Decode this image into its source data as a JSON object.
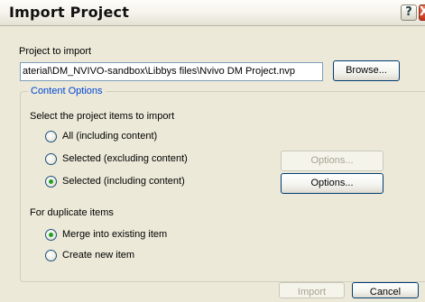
{
  "window": {
    "title": "Import Project",
    "help_glyph": "?",
    "close_glyph": "X"
  },
  "project": {
    "label": "Project to import",
    "path_value": "aterial\\DM_NVIVO-sandbox\\Libbys files\\Nvivo DM Project.nvp",
    "browse_label": "Browse..."
  },
  "content_options": {
    "legend": "Content Options",
    "prompt": "Select the project items to import",
    "items": [
      {
        "label": "All (including content)",
        "selected": false
      },
      {
        "label": "Selected (excluding content)",
        "selected": false,
        "options_label": "Options...",
        "options_enabled": false
      },
      {
        "label": "Selected (including content)",
        "selected": true,
        "options_label": "Options...",
        "options_enabled": true
      }
    ]
  },
  "duplicates": {
    "label": "For duplicate items",
    "items": [
      {
        "label": "Merge into existing item",
        "selected": true
      },
      {
        "label": "Create new item",
        "selected": false
      }
    ]
  },
  "footer": {
    "import_label": "Import",
    "import_enabled": false,
    "cancel_label": "Cancel"
  }
}
